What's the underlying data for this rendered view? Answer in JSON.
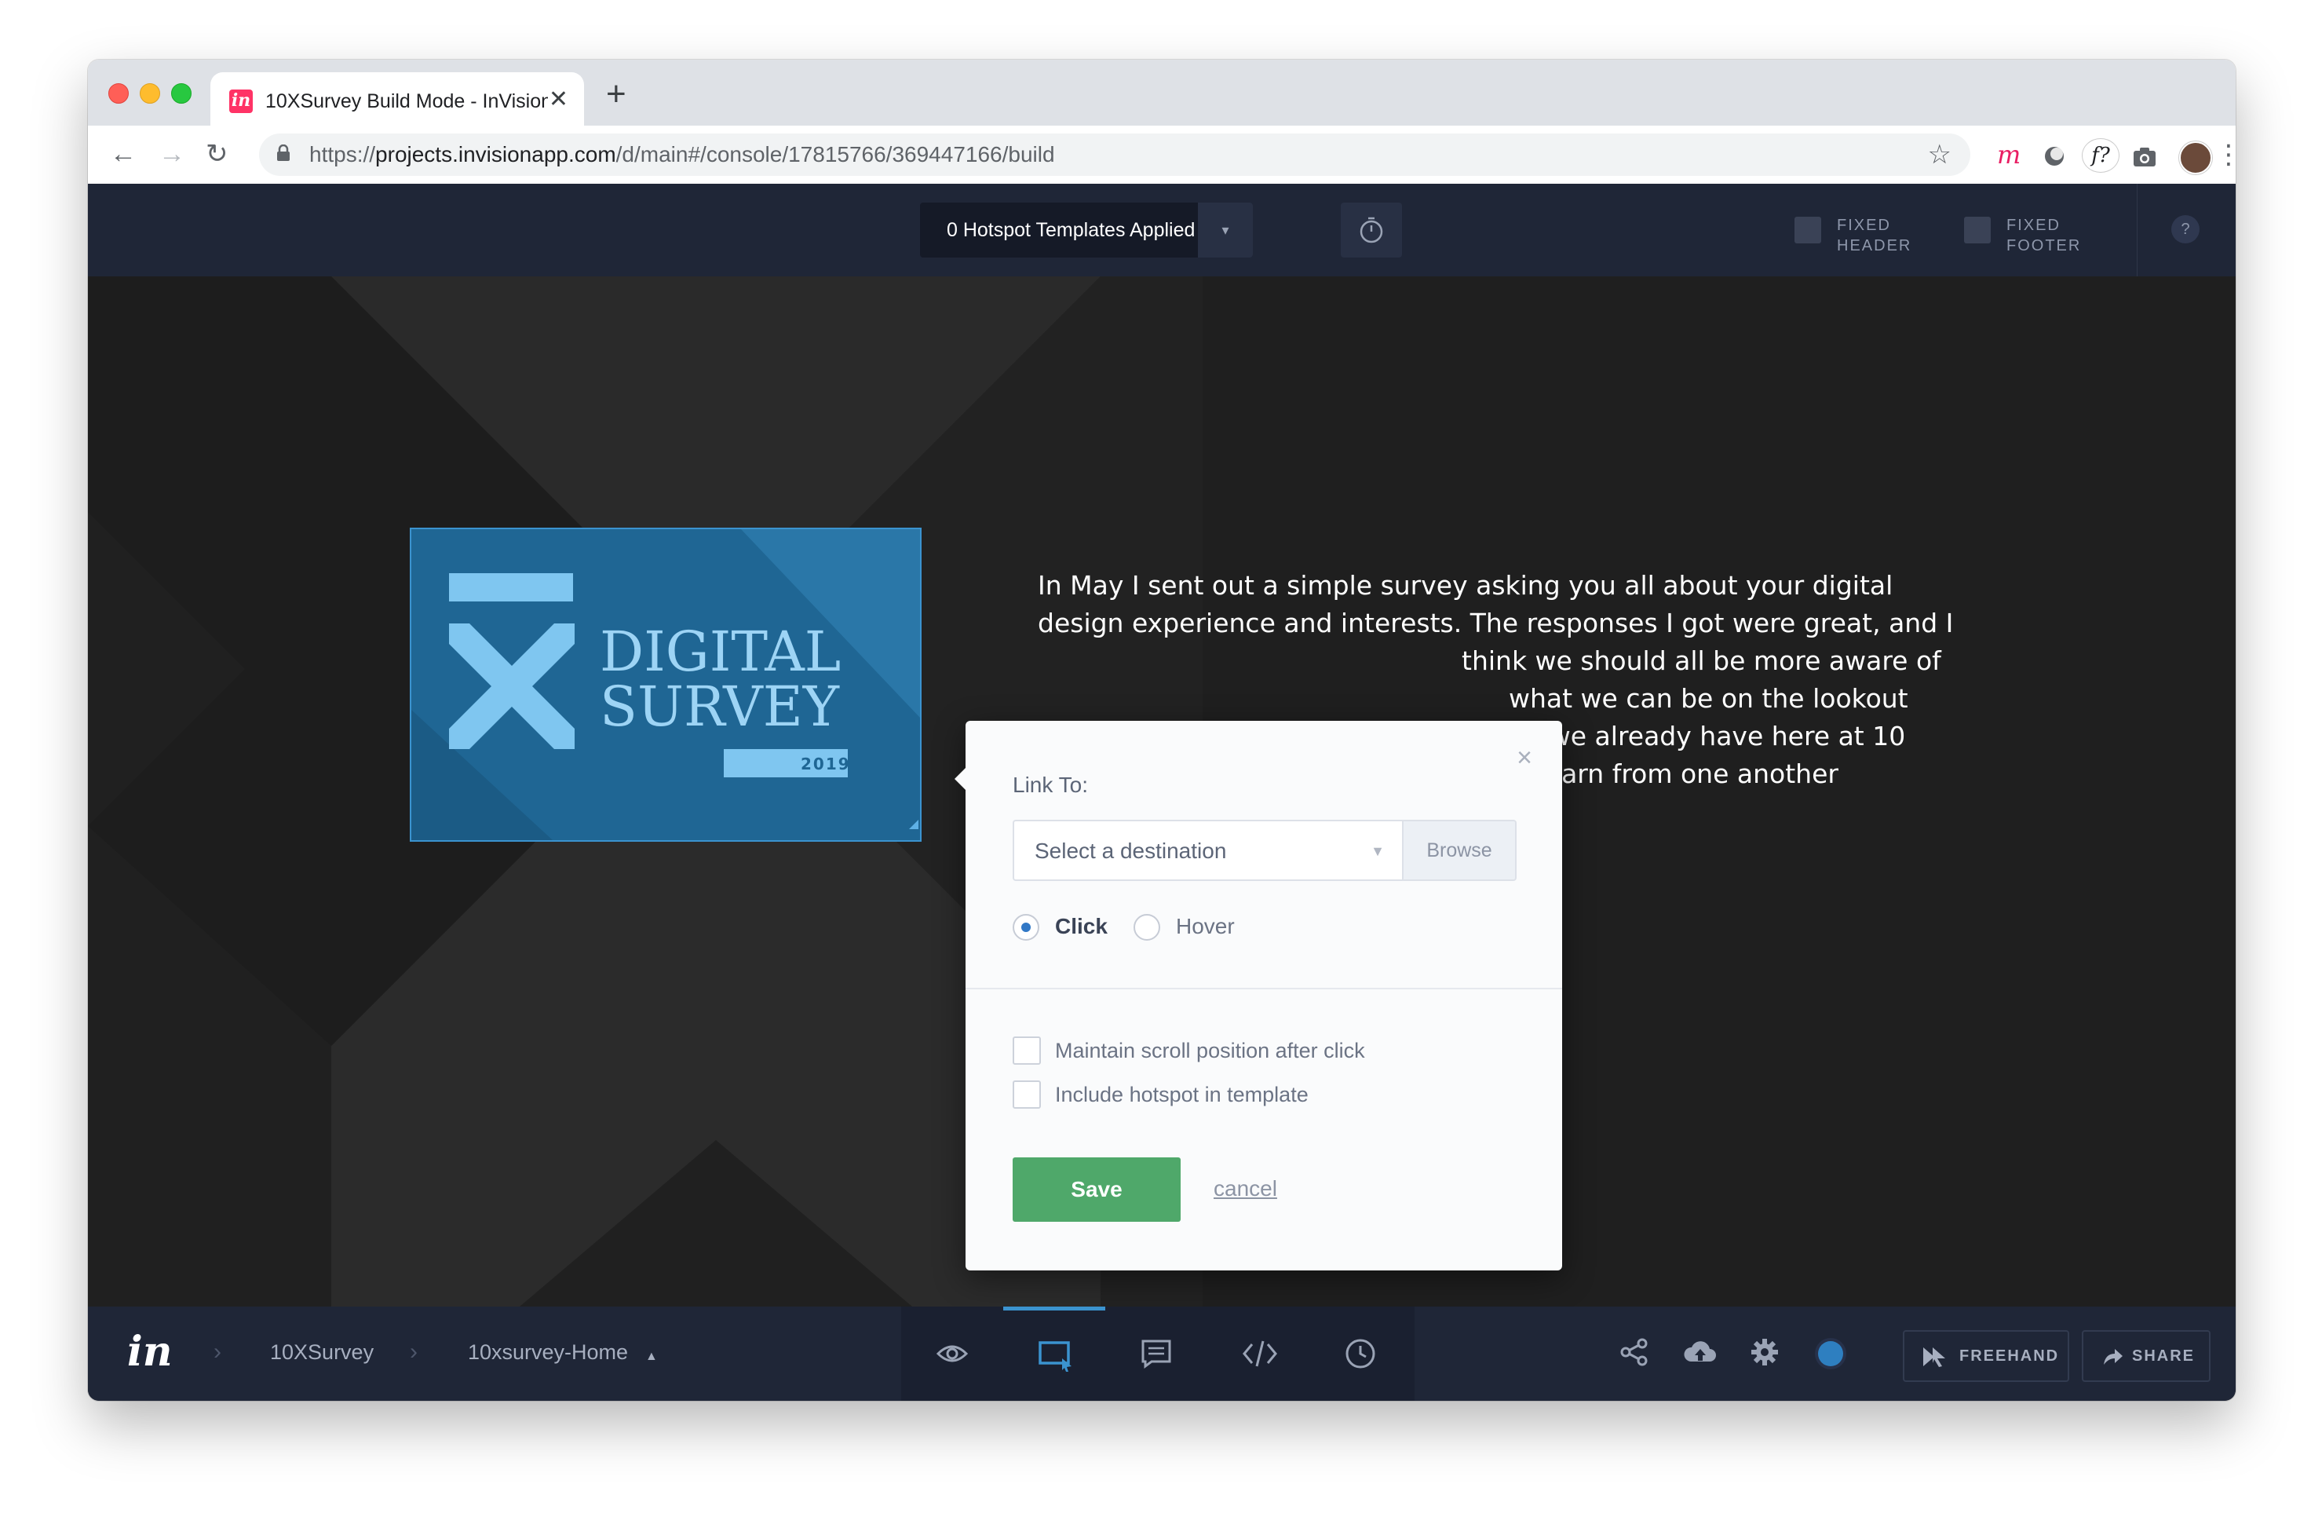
{
  "browser": {
    "tab_title": "10XSurvey Build Mode - InVision",
    "tab_favicon": "in",
    "new_tab_label": "+",
    "url_prefix": "https://",
    "url_host": "projects.invisionapp.com",
    "url_path": "/d/main#/console/17815766/369447166/build",
    "extensions": [
      "m",
      "f?"
    ]
  },
  "topbar": {
    "hotspot_templates_label": "0 Hotspot Templates Applied",
    "fixed_header_label": [
      "FIXED",
      "HEADER"
    ],
    "fixed_footer_label": [
      "FIXED",
      "FOOTER"
    ],
    "help_label": "?"
  },
  "canvas": {
    "image": {
      "title_line1": "DIGITAL",
      "title_line2": "SURVEY",
      "year": "2019"
    },
    "body_lines": [
      "In May I sent out a simple survey asking you all about your digital",
      "design experience and interests. The responses I got were great, and I",
      "think we should all be more aware of",
      "what we can be on the lookout",
      "for as we already have here at 10",
      "to learn from one another"
    ]
  },
  "modal": {
    "title": "Link To:",
    "close_label": "×",
    "destination_placeholder": "Select a destination",
    "browse_label": "Browse",
    "trigger_options": [
      {
        "label": "Click",
        "selected": true
      },
      {
        "label": "Hover",
        "selected": false
      }
    ],
    "checkboxes": [
      {
        "label": "Maintain scroll position after click",
        "checked": false
      },
      {
        "label": "Include hotspot in template",
        "checked": false
      }
    ],
    "save_label": "Save",
    "cancel_label": "cancel"
  },
  "bottombar": {
    "logo": "in",
    "breadcrumb": [
      "10XSurvey",
      "10xsurvey-Home"
    ],
    "modes": [
      "preview-eye-icon",
      "build-hotspot-icon",
      "comment-icon",
      "inspect-code-icon",
      "history-clock-icon"
    ],
    "active_mode": "build-hotspot-icon",
    "freehand_label": "FREEHAND",
    "share_label": "SHARE"
  },
  "colors": {
    "accent_blue": "#3b93cf",
    "save_green": "#4fa86a",
    "topbar_bg": "#1f2637",
    "canvas_bg": "#1f1f1f",
    "brand_pink": "#ff3366"
  }
}
